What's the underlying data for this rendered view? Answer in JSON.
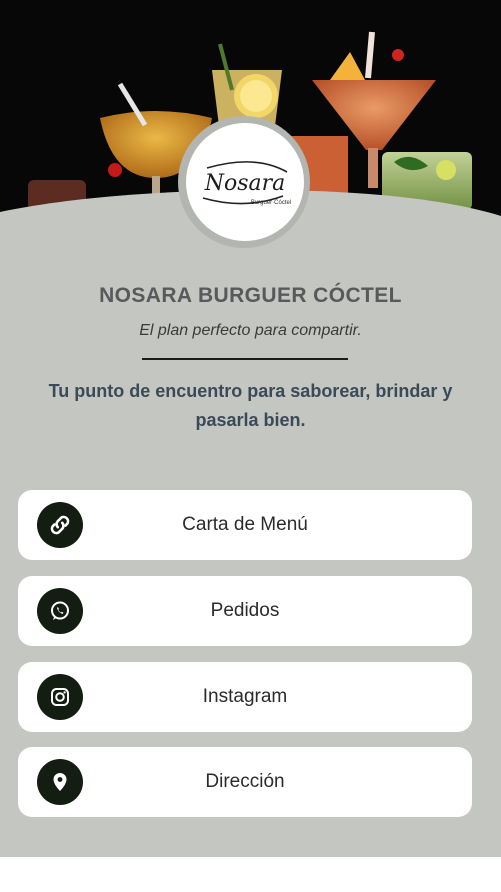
{
  "header": {
    "logo_name": "Nosara",
    "logo_sub": "Burguer·Cóctel"
  },
  "profile": {
    "title": "NOSARA BURGUER CÓCTEL",
    "tagline": "El plan perfecto para compartir.",
    "description": "Tu punto de encuentro para saborear, brindar y pasarla bien."
  },
  "links": [
    {
      "label": "Carta de Menú",
      "icon": "link-icon"
    },
    {
      "label": "Pedidos",
      "icon": "whatsapp-icon"
    },
    {
      "label": "Instagram",
      "icon": "instagram-icon"
    },
    {
      "label": "Dirección",
      "icon": "location-pin-icon"
    }
  ],
  "colors": {
    "background": "#c4c6c2",
    "button": "#ffffff",
    "icon_circle": "#141d12",
    "hero": "#070707"
  }
}
